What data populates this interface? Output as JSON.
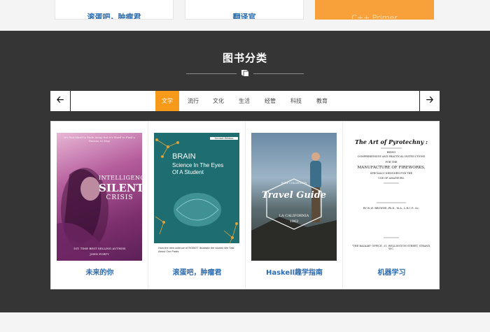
{
  "top_cards": [
    {
      "label": "滚蛋吧，肿瘤君"
    },
    {
      "label": "翻译官"
    },
    {
      "label": "C++ Primer"
    }
  ],
  "section": {
    "title": "图书分类",
    "divider_icon": "book-icon"
  },
  "nav": {
    "prev_icon": "arrow-left-icon",
    "next_icon": "arrow-right-icon",
    "tabs": [
      {
        "label": "文学",
        "active": true
      },
      {
        "label": "流行"
      },
      {
        "label": "文化"
      },
      {
        "label": "生活"
      },
      {
        "label": "经管"
      },
      {
        "label": "科技"
      },
      {
        "label": "教育"
      }
    ]
  },
  "books": [
    {
      "title": "未来的你",
      "cover": {
        "top_text": "It's Not Hard to Fade Away but it's Hard to Find a Reason to Stay",
        "headline": [
          "INTELLIGENCE",
          "SILENT",
          "CRISIS"
        ],
        "footer": "1ST. TIME BEST SELLING AUTHOR",
        "author": "JOHN FORTY"
      }
    },
    {
      "title": "滚蛋吧，肿瘤君",
      "cover": {
        "badge": "Second Edition",
        "headline": [
          "BRAIN",
          "Science In The Eyes",
          "Of A Student"
        ],
        "footer": "How the new science of ROBOT Illustrate the stories We Talk About Our Pasts"
      }
    },
    {
      "title": "Haskell趣学指南",
      "cover": {
        "top_text": "SURF COLLECTION",
        "headline": [
          "Travel Guide"
        ],
        "sub": "LA CALIFORNIA",
        "year": "1962"
      }
    },
    {
      "title": "机器学习",
      "cover": {
        "headline": [
          "The Art of Pyrotechny :"
        ],
        "lines": [
          "BEING",
          "COMPREHENSIVE AND PRACTICAL INSTRUCTIONS",
          "FOR THE",
          "MANUFACTURE OF FIREWORKS,",
          "SPECIALLY DESIGNED FOR THE",
          "USE OF AMATEURS."
        ],
        "author": "BY W. H. BROWNE, Ph.D., M.A., L.R.C.P., &c.",
        "publisher": "\"THE BAZAAR\" OFFICE, 31, WELLINGTON STREET, STRAND, W.C."
      }
    }
  ]
}
